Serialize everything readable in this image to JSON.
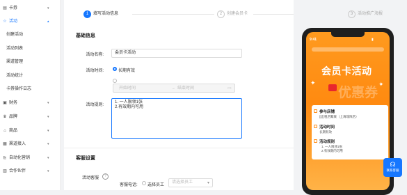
{
  "sidebar": {
    "items": [
      {
        "icon": "card-icon",
        "glyph": "▤",
        "label": "卡券",
        "expanded": false
      },
      {
        "icon": "star-icon",
        "glyph": "☆",
        "label": "活动",
        "expanded": true
      },
      {
        "icon": "wallet-icon",
        "glyph": "▣",
        "label": "财务",
        "expanded": false
      },
      {
        "icon": "crown-icon",
        "glyph": "♛",
        "label": "品牌",
        "expanded": false
      },
      {
        "icon": "store-icon",
        "glyph": "⌂",
        "label": "商品",
        "expanded": false
      },
      {
        "icon": "channel-icon",
        "glyph": "▦",
        "label": "渠道接入",
        "expanded": false
      },
      {
        "icon": "marketing-icon",
        "glyph": "⊵",
        "label": "自动化营销",
        "expanded": false
      },
      {
        "icon": "partner-icon",
        "glyph": "▥",
        "label": "合作伙伴",
        "expanded": false
      }
    ],
    "subitems": [
      "创建活动",
      "活动列表",
      "渠道管理",
      "活动统计",
      "卡券操作日志"
    ]
  },
  "steps": [
    {
      "num": "1",
      "label": "填写活动信息",
      "active": true
    },
    {
      "num": "2",
      "label": "创建会员卡",
      "active": false
    },
    {
      "num": "3",
      "label": "活动推广海报",
      "active": false
    }
  ],
  "basic": {
    "title": "基础信息",
    "name_label": "活动名称:",
    "name_value": "会员卡活动",
    "time_label": "活动时间:",
    "time_option": "长期有效",
    "start_placeholder": "开始时间",
    "end_placeholder": "结束时间",
    "rules_label": "活动规则:",
    "rules_value": "1. 一人限领1张\n2.有效期内可用"
  },
  "service": {
    "title": "客服设置",
    "label": "活动客服",
    "help_icon": "question-circle-icon",
    "method_label": "客服电话:",
    "option": "选择员工",
    "select_placeholder": "请选择员工"
  },
  "preview": {
    "time": "9:41",
    "banner_title": "会员卡活动",
    "watermark": "优惠券",
    "rows": [
      {
        "title": "参与店铺",
        "text": "[]出租店聚联（上海瑞阳店）"
      },
      {
        "title": "活动时间",
        "text": "长期有效"
      },
      {
        "title": "活动规则",
        "text": "1. 一人限领1张\n2.有效期内可用"
      }
    ],
    "service_label": "联系客服"
  },
  "colors": {
    "accent": "#1677ff",
    "orange": "#ff8a10"
  }
}
